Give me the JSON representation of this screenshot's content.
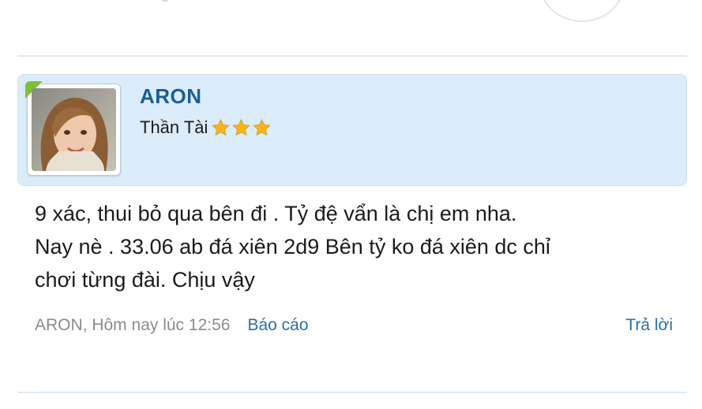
{
  "post": {
    "author": {
      "name": "ARON",
      "title": "Thần Tài",
      "stars": 3,
      "avatar_icon": "avatar-photo",
      "accent_color": "#7fbf3a"
    },
    "message_lines": [
      "9 xác, thui bỏ qua bên đi . Tỷ đệ vẩn là chị em nha.",
      "Nay nè . 33.06 ab đá xiên 2d9 Bên tỷ ko đá xiên dc chỉ",
      "chơi từng đài. Chịu vậy"
    ],
    "meta": {
      "byline": "ARON, Hôm nay lúc 12:56",
      "report_label": "Báo cáo",
      "reply_label": "Trả lời"
    }
  },
  "colors": {
    "author_bar_bg": "#dbecfa",
    "name_color": "#1b5e96",
    "link_color": "#2770a8",
    "star_color": "#f5b51c"
  }
}
